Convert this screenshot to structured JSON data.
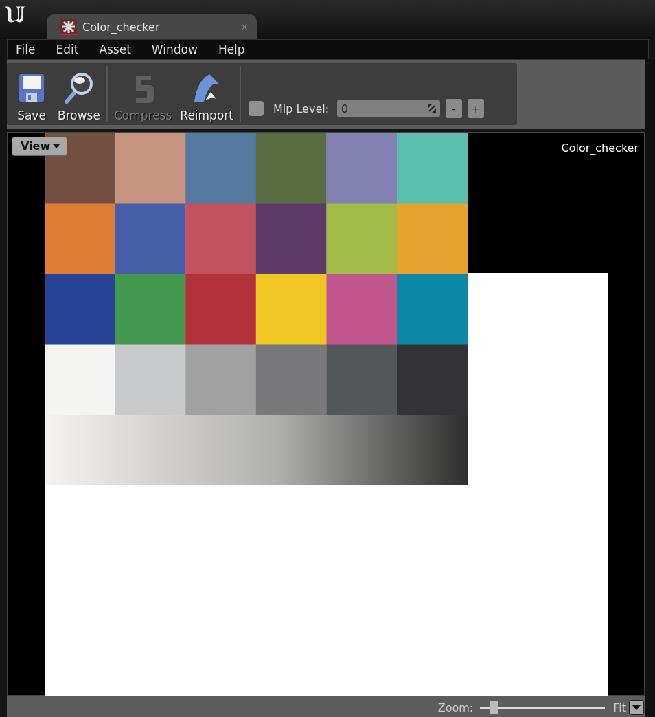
{
  "tab": {
    "title": "Color_checker",
    "close": "×"
  },
  "menu": [
    "File",
    "Edit",
    "Asset",
    "Window",
    "Help"
  ],
  "toolbar": {
    "buttons": [
      {
        "kind": "save",
        "label": "Save",
        "disabled": false
      },
      {
        "kind": "browse",
        "label": "Browse",
        "disabled": false
      },
      {
        "kind": "compress",
        "label": "Compress",
        "disabled": true
      },
      {
        "kind": "reimport",
        "label": "Reimport",
        "disabled": false
      }
    ],
    "mip": {
      "checked": false,
      "label": "Mip Level:",
      "value": "0",
      "buttons": [
        "-",
        "+"
      ]
    }
  },
  "viewport": {
    "view_button": "View",
    "texture_name": "Color_checker"
  },
  "zoom": {
    "label": "Zoom:",
    "level": 0.08,
    "fit": "Fit"
  }
}
